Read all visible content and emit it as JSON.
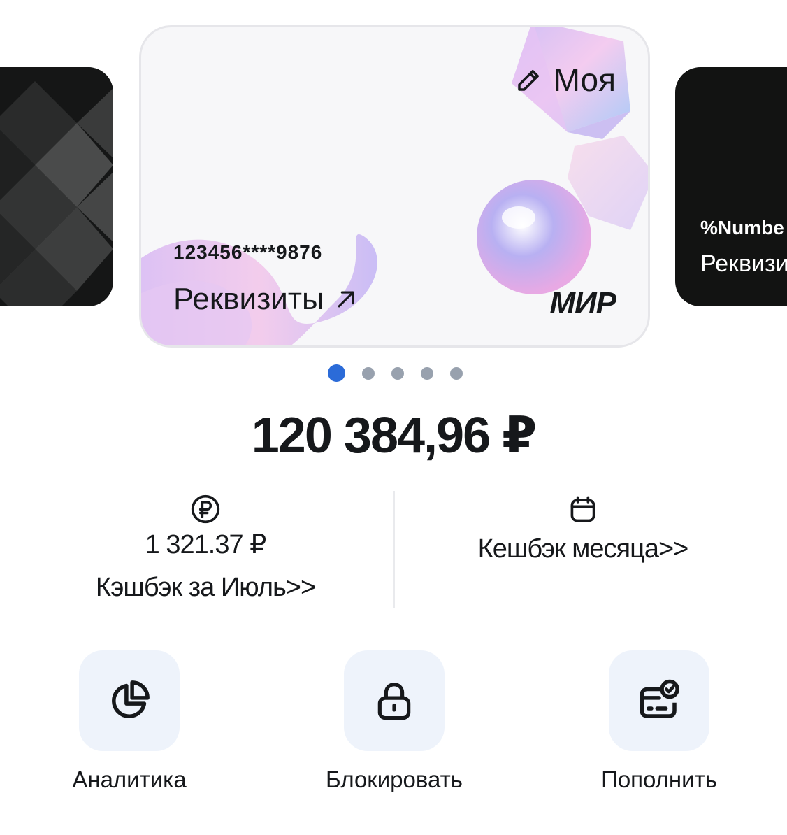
{
  "cards": {
    "main": {
      "name_label": "Моя",
      "number_masked": "123456****9876",
      "requisites_label": "Реквизиты",
      "payment_system": "МИР",
      "icons": {
        "edit": "pencil-icon",
        "open": "arrow-up-right-icon"
      }
    },
    "next": {
      "number_masked": "%Numbe",
      "requisites_label": "Реквизи"
    }
  },
  "pagination": {
    "count": 5,
    "active_index": 0
  },
  "balance": {
    "amount": "120 384,96 ₽"
  },
  "cashback": {
    "previous": {
      "icon": "ruble-coin-icon",
      "amount": "1 321.37 ₽",
      "link": "Кэшбэк за Июль>>"
    },
    "current": {
      "icon": "calendar-icon",
      "link": "Кешбэк месяца>>"
    }
  },
  "actions": [
    {
      "icon": "pie-chart-icon",
      "label": "Аналитика"
    },
    {
      "icon": "lock-icon",
      "label": "Блокировать"
    },
    {
      "icon": "card-check-icon",
      "label": "Пополнить"
    }
  ],
  "colors": {
    "accent": "#2b6bd8",
    "dot_inactive": "#98a1ae",
    "tile_background": "#eef3fb",
    "dark_card": "#151616",
    "text": "#16181b"
  }
}
